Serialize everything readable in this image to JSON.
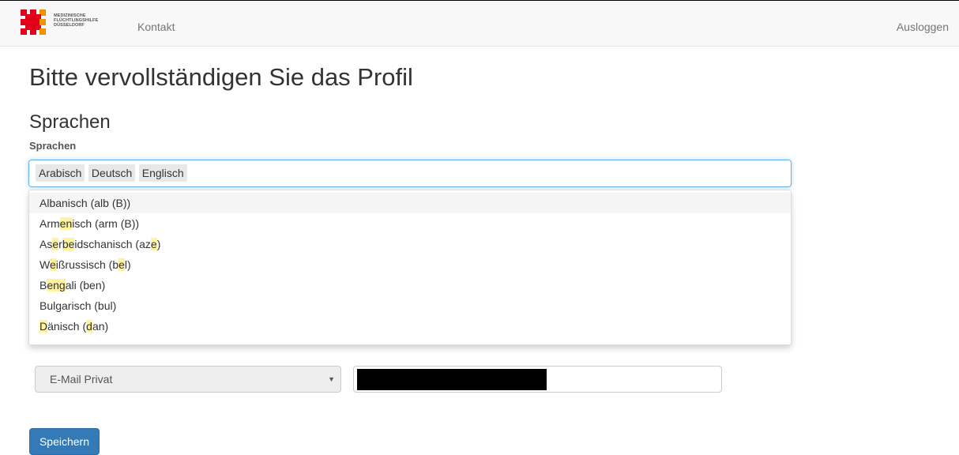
{
  "header": {
    "logo_lines": [
      "MEDIZINISCHE",
      "FLÜCHTLINGSHILFE",
      "DÜSSELDORF"
    ],
    "nav_contact": "Kontakt",
    "logout": "Ausloggen"
  },
  "page_title": "Bitte vervollständigen Sie das Profil",
  "languages_section": {
    "title": "Sprachen",
    "field_label": "Sprachen",
    "selected": [
      "Arabisch",
      "Deutsch",
      "Englisch"
    ],
    "options": [
      {
        "label": "Albanisch (alb (B))",
        "active": true,
        "segments": [
          {
            "t": "Albanisch (alb (B))",
            "h": false
          }
        ]
      },
      {
        "label": "Armenisch (arm (B))",
        "active": false,
        "segments": [
          {
            "t": "Arm",
            "h": false
          },
          {
            "t": "en",
            "h": true
          },
          {
            "t": "isch (arm (B))",
            "h": false
          }
        ]
      },
      {
        "label": "Aserbeidschanisch (aze)",
        "active": false,
        "segments": [
          {
            "t": "As",
            "h": false
          },
          {
            "t": "e",
            "h": true
          },
          {
            "t": "r",
            "h": false
          },
          {
            "t": "be",
            "h": true
          },
          {
            "t": "idschanisch (az",
            "h": false
          },
          {
            "t": "e",
            "h": true
          },
          {
            "t": ")",
            "h": false
          }
        ]
      },
      {
        "label": "Weißrussisch (bel)",
        "active": false,
        "segments": [
          {
            "t": "W",
            "h": false
          },
          {
            "t": "e",
            "h": true
          },
          {
            "t": "ißrussisch (b",
            "h": false
          },
          {
            "t": "e",
            "h": true
          },
          {
            "t": "l)",
            "h": false
          }
        ]
      },
      {
        "label": "Bengali (ben)",
        "active": false,
        "segments": [
          {
            "t": "B",
            "h": false
          },
          {
            "t": "eng",
            "h": true
          },
          {
            "t": "ali (ben)",
            "h": false
          }
        ]
      },
      {
        "label": "Bulgarisch (bul)",
        "active": false,
        "segments": [
          {
            "t": "Bulgarisch (bul)",
            "h": false
          }
        ]
      },
      {
        "label": "Dänisch (dan)",
        "active": false,
        "segments": [
          {
            "t": "D",
            "h": true
          },
          {
            "t": "änisch (",
            "h": false
          },
          {
            "t": "d",
            "h": true
          },
          {
            "t": "an)",
            "h": false
          }
        ]
      }
    ]
  },
  "contact": {
    "type_select_value": "E-Mail Privat",
    "caret_glyph": "▼"
  },
  "save_button": "Speichern",
  "colors": {
    "primary": "#337ab7",
    "highlight": "#fff3a3",
    "focus_border": "#66afe9"
  }
}
